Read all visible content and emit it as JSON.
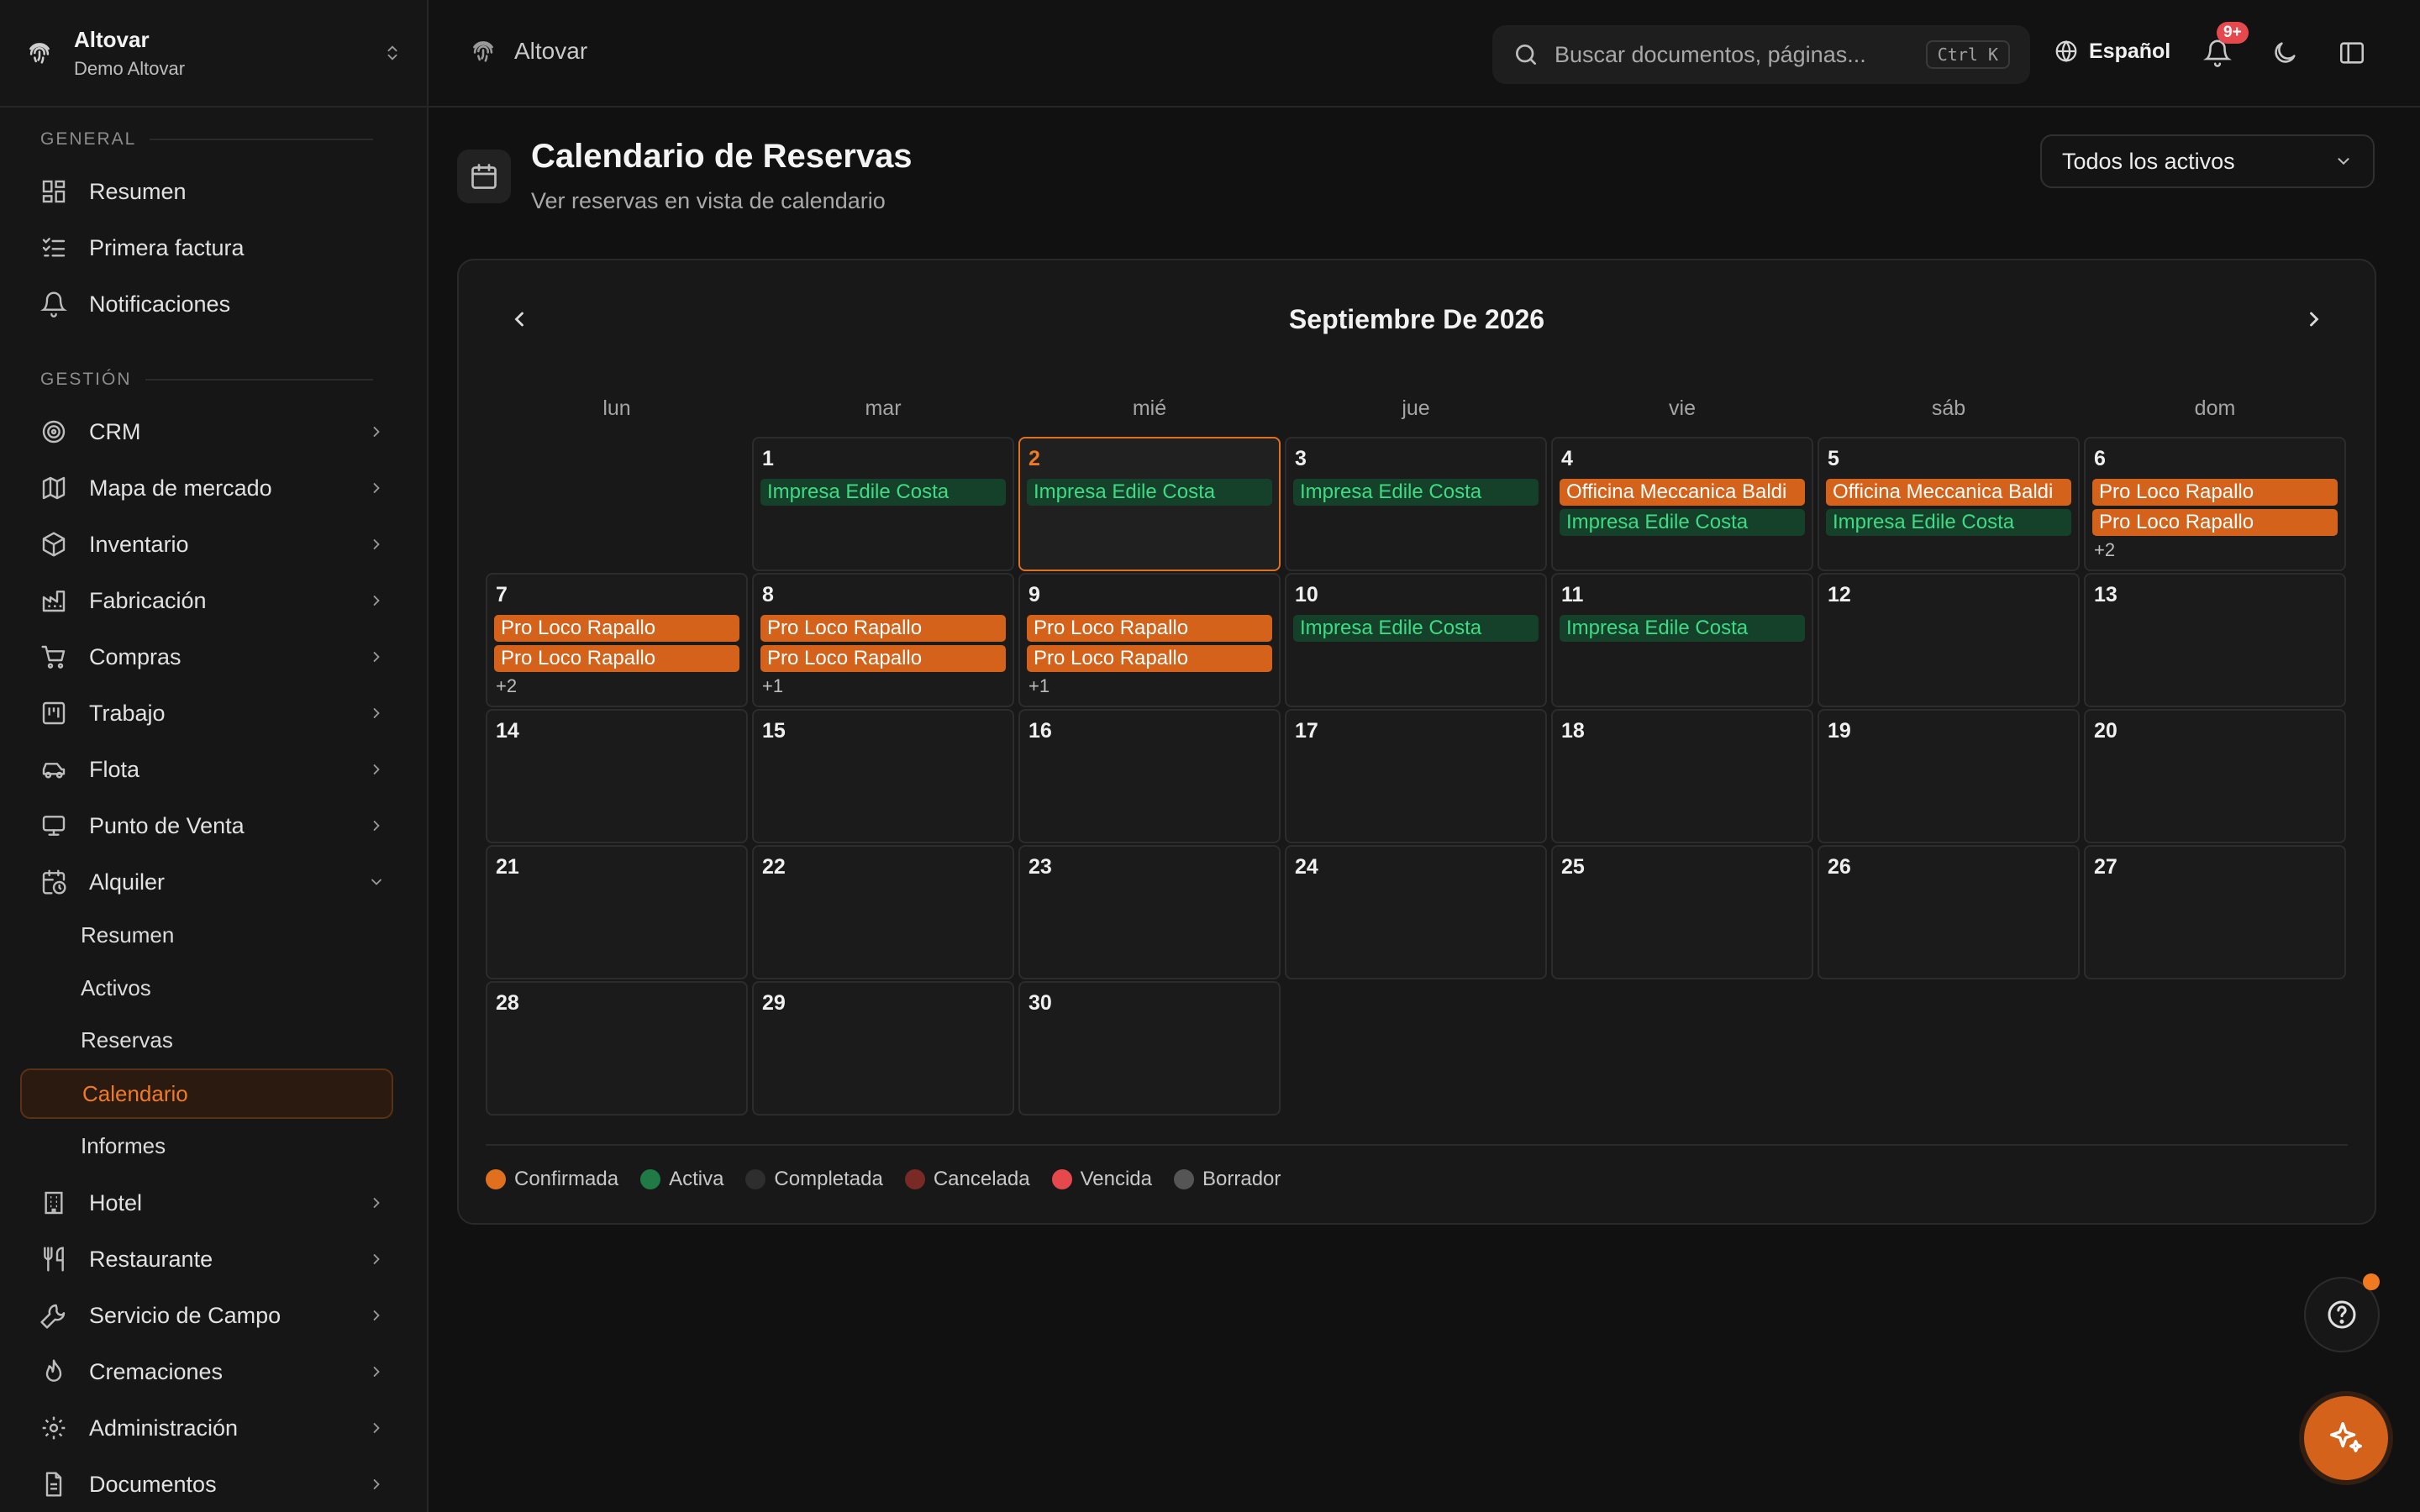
{
  "org": {
    "name": "Altovar",
    "subtitle": "Demo Altovar"
  },
  "sidebar": {
    "general_label": "GENERAL",
    "general": [
      {
        "label": "Resumen",
        "icon": "dashboard-icon"
      },
      {
        "label": "Primera factura",
        "icon": "checklist-icon"
      },
      {
        "label": "Notificaciones",
        "icon": "bell-icon"
      }
    ],
    "gestion_label": "GESTIÓN",
    "gestion": [
      {
        "label": "CRM",
        "icon": "target-icon"
      },
      {
        "label": "Mapa de mercado",
        "icon": "map-icon"
      },
      {
        "label": "Inventario",
        "icon": "box-icon"
      },
      {
        "label": "Fabricación",
        "icon": "factory-icon"
      },
      {
        "label": "Compras",
        "icon": "cart-icon"
      },
      {
        "label": "Trabajo",
        "icon": "kanban-icon"
      },
      {
        "label": "Flota",
        "icon": "car-icon"
      },
      {
        "label": "Punto de Venta",
        "icon": "monitor-icon"
      },
      {
        "label": "Alquiler",
        "icon": "calendar-clock-icon"
      }
    ],
    "alquiler_sub": [
      "Resumen",
      "Activos",
      "Reservas",
      "Calendario",
      "Informes"
    ],
    "more": [
      {
        "label": "Hotel",
        "icon": "building-icon"
      },
      {
        "label": "Restaurante",
        "icon": "utensils-icon"
      },
      {
        "label": "Servicio de Campo",
        "icon": "wrench-icon"
      },
      {
        "label": "Cremaciones",
        "icon": "flame-icon"
      },
      {
        "label": "Administración",
        "icon": "gear-icon"
      },
      {
        "label": "Documentos",
        "icon": "document-icon"
      }
    ]
  },
  "topbar": {
    "breadcrumb": "Altovar",
    "search_placeholder": "Buscar documentos, páginas...",
    "search_shortcut": "Ctrl K",
    "language": "Español",
    "notifications_badge": "9+"
  },
  "page": {
    "title": "Calendario de Reservas",
    "subtitle": "Ver reservas en vista de calendario",
    "asset_filter": "Todos los activos"
  },
  "calendar": {
    "month_title": "Septiembre De 2026",
    "weekdays": [
      "lun",
      "mar",
      "mié",
      "jue",
      "vie",
      "sáb",
      "dom"
    ],
    "first_weekday_index": 1,
    "today": 2,
    "days": [
      {
        "n": "1",
        "events": [
          {
            "t": "Impresa Edile Costa",
            "s": "green"
          }
        ]
      },
      {
        "n": "2",
        "events": [
          {
            "t": "Impresa Edile Costa",
            "s": "green"
          }
        ]
      },
      {
        "n": "3",
        "events": [
          {
            "t": "Impresa Edile Costa",
            "s": "green"
          }
        ]
      },
      {
        "n": "4",
        "events": [
          {
            "t": "Officina Meccanica Baldi",
            "s": "orange"
          },
          {
            "t": "Impresa Edile Costa",
            "s": "green"
          }
        ]
      },
      {
        "n": "5",
        "events": [
          {
            "t": "Officina Meccanica Baldi",
            "s": "orange"
          },
          {
            "t": "Impresa Edile Costa",
            "s": "green"
          }
        ]
      },
      {
        "n": "6",
        "events": [
          {
            "t": "Pro Loco Rapallo",
            "s": "orange"
          },
          {
            "t": "Pro Loco Rapallo",
            "s": "orange"
          }
        ],
        "more": "+2"
      },
      {
        "n": "7",
        "events": [
          {
            "t": "Pro Loco Rapallo",
            "s": "orange"
          },
          {
            "t": "Pro Loco Rapallo",
            "s": "orange"
          }
        ],
        "more": "+2"
      },
      {
        "n": "8",
        "events": [
          {
            "t": "Pro Loco Rapallo",
            "s": "orange"
          },
          {
            "t": "Pro Loco Rapallo",
            "s": "orange"
          }
        ],
        "more": "+1"
      },
      {
        "n": "9",
        "events": [
          {
            "t": "Pro Loco Rapallo",
            "s": "orange"
          },
          {
            "t": "Pro Loco Rapallo",
            "s": "orange"
          }
        ],
        "more": "+1"
      },
      {
        "n": "10",
        "events": [
          {
            "t": "Impresa Edile Costa",
            "s": "green"
          }
        ]
      },
      {
        "n": "11",
        "events": [
          {
            "t": "Impresa Edile Costa",
            "s": "green"
          }
        ]
      },
      {
        "n": "12",
        "events": []
      },
      {
        "n": "13",
        "events": []
      },
      {
        "n": "14",
        "events": []
      },
      {
        "n": "15",
        "events": []
      },
      {
        "n": "16",
        "events": []
      },
      {
        "n": "17",
        "events": []
      },
      {
        "n": "18",
        "events": []
      },
      {
        "n": "19",
        "events": []
      },
      {
        "n": "20",
        "events": []
      },
      {
        "n": "21",
        "events": []
      },
      {
        "n": "22",
        "events": []
      },
      {
        "n": "23",
        "events": []
      },
      {
        "n": "24",
        "events": []
      },
      {
        "n": "25",
        "events": []
      },
      {
        "n": "26",
        "events": []
      },
      {
        "n": "27",
        "events": []
      },
      {
        "n": "28",
        "events": []
      },
      {
        "n": "29",
        "events": []
      },
      {
        "n": "30",
        "events": []
      }
    ],
    "legend": [
      {
        "label": "Confirmada",
        "color": "#e0701e"
      },
      {
        "label": "Activa",
        "color": "#1f7a45"
      },
      {
        "label": "Completada",
        "color": "#2e2e2e"
      },
      {
        "label": "Cancelada",
        "color": "#7a2a24"
      },
      {
        "label": "Vencida",
        "color": "#e5484d"
      },
      {
        "label": "Borrador",
        "color": "#555555"
      }
    ]
  },
  "colors": {
    "accent": "#e0701e",
    "active_green": "#3ddc84"
  }
}
